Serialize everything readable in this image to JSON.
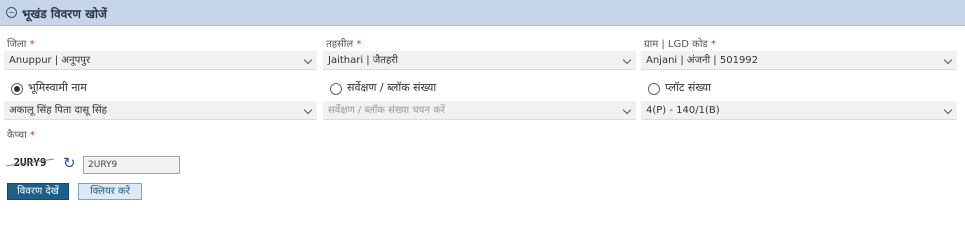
{
  "header": {
    "title": "भूखंड विवरण खोजें",
    "collapse_icon": "minus-circle-icon"
  },
  "fields": {
    "district": {
      "label": "जिला",
      "value": "Anuppur | अनूपपुर"
    },
    "tehsil": {
      "label": "तहसील",
      "value": "Jaithari | जैतहरी"
    },
    "village": {
      "label": "ग्राम | LGD कोड",
      "value": "Anjani | अंजनी | 501992"
    }
  },
  "required_mark": "*",
  "search_by": {
    "options": [
      {
        "label": "भूमिस्वामी नाम",
        "selected": true
      },
      {
        "label": "सर्वेक्षण / ब्लॉक संख्या",
        "selected": false
      },
      {
        "label": "प्लॉट संख्या",
        "selected": false
      }
    ],
    "owner_value": "अकालू सिंह पिता दासू सिंह",
    "survey_placeholder": "सर्वेक्षण / ब्लॉक संख्या चयन करें",
    "plot_value": "4(P) - 140/1(B)"
  },
  "captcha": {
    "label": "कैप्चा",
    "image_text": "2URY9",
    "input_value": "2URY9"
  },
  "buttons": {
    "view": "विवरण देखें",
    "clear": "क्लियर करें"
  }
}
